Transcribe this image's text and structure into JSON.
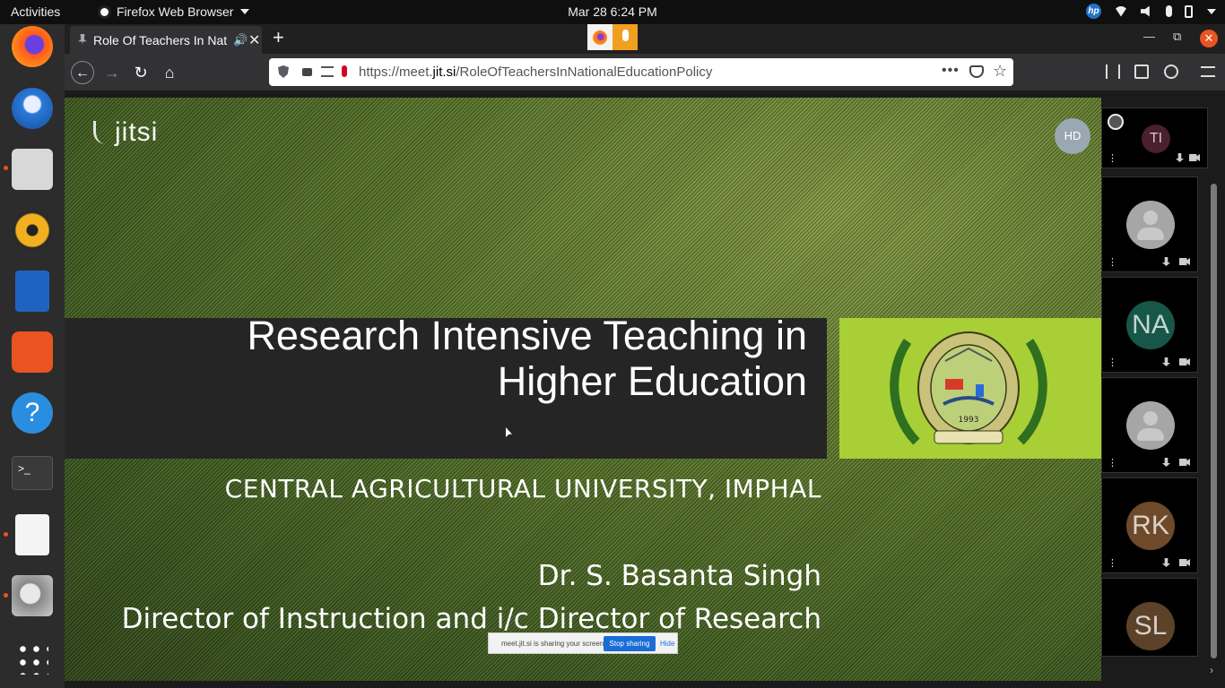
{
  "topbar": {
    "activities": "Activities",
    "app_name": "Firefox Web Browser",
    "clock": "Mar 28  6:24 PM",
    "tray_icons": [
      "hp-icon",
      "wifi-icon",
      "volume-icon",
      "mic-icon",
      "battery-icon",
      "system-menu-icon"
    ]
  },
  "dock": {
    "apps": [
      "firefox-icon",
      "thunderbird-icon",
      "files-icon",
      "rhythmbox-icon",
      "libreoffice-impress-icon",
      "ubuntu-software-icon",
      "help-icon",
      "terminal-icon",
      "text-editor-icon",
      "screenshot-icon",
      "show-applications-icon"
    ]
  },
  "browser": {
    "tab_title": "Role Of Teachers In National Education Policy",
    "url_host": "https://meet.",
    "url_domain": "jit.si",
    "url_path": "/RoleOfTeachersInNationalEducationPolicy",
    "url_more": "•••"
  },
  "meeting": {
    "logo_text": "jitsi",
    "host_initials": "HD",
    "slide": {
      "title_line1": "Research Intensive Teaching in",
      "title_line2": "Higher Education",
      "university": "CENTRAL AGRICULTURAL UNIVERSITY, IMPHAL",
      "speaker": "Dr. S. Basanta Singh",
      "role": "Director of Instruction and i/c Director of Research",
      "seal_year": "1993"
    },
    "share_bar": {
      "message": "meet.jit.si is sharing your screen.",
      "stop": "Stop sharing",
      "hide": "Hide"
    },
    "participants": [
      {
        "initials": "TI",
        "color": "#4a1f2f"
      },
      {
        "initials": "",
        "color": "#a6a6a6"
      },
      {
        "initials": "NA",
        "color": "#17574a"
      },
      {
        "initials": "",
        "color": "#a6a6a6"
      },
      {
        "initials": "RK",
        "color": "#6e4a2a"
      },
      {
        "initials": "SL",
        "color": "#5c4228"
      }
    ]
  }
}
